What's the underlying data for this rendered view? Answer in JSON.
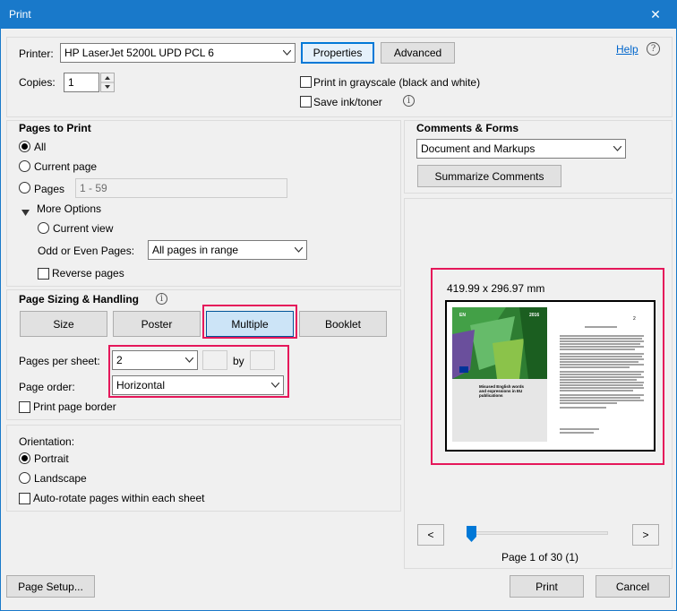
{
  "window": {
    "title": "Print",
    "close_glyph": "✕"
  },
  "printer": {
    "label": "Printer:",
    "value": "HP LaserJet 5200L UPD PCL 6",
    "properties": "Properties",
    "advanced": "Advanced",
    "help": "Help"
  },
  "copies": {
    "label": "Copies:",
    "value": "1"
  },
  "options": {
    "grayscale": "Print in grayscale (black and white)",
    "save_ink": "Save ink/toner"
  },
  "pages_to_print": {
    "title": "Pages to Print",
    "all": "All",
    "current_page": "Current page",
    "pages": "Pages",
    "pages_placeholder": "1 - 59",
    "more_options": "More Options",
    "current_view": "Current view",
    "odd_even_label": "Odd or Even Pages:",
    "odd_even_value": "All pages in range",
    "reverse": "Reverse pages"
  },
  "sizing": {
    "title": "Page Sizing & Handling",
    "tabs": [
      "Size",
      "Poster",
      "Multiple",
      "Booklet"
    ],
    "pages_per_sheet_label": "Pages per sheet:",
    "pages_per_sheet_value": "2",
    "by": "by",
    "page_order_label": "Page order:",
    "page_order_value": "Horizontal",
    "border": "Print page border"
  },
  "orientation": {
    "title": "Orientation:",
    "portrait": "Portrait",
    "landscape": "Landscape",
    "auto_rotate": "Auto-rotate pages within each sheet"
  },
  "comments": {
    "title": "Comments & Forms",
    "value": "Document and Markups",
    "summarize": "Summarize Comments"
  },
  "preview": {
    "size": "419.99 x 296.97 mm",
    "page_info": "Page 1 of 30 (1)",
    "prev": "<",
    "next": ">",
    "slider_fraction": 0.0,
    "thumb_left": {
      "code": "EN",
      "year": "2016",
      "caption": "Misused English words and expressions in EU publications"
    },
    "thumb_right": {
      "number": "2"
    }
  },
  "footer": {
    "page_setup": "Page Setup...",
    "print": "Print",
    "cancel": "Cancel"
  },
  "colors": {
    "accent": "#1979ca",
    "highlight": "#e5175a",
    "green": "#4caf50",
    "purple": "#6a4f9c"
  }
}
